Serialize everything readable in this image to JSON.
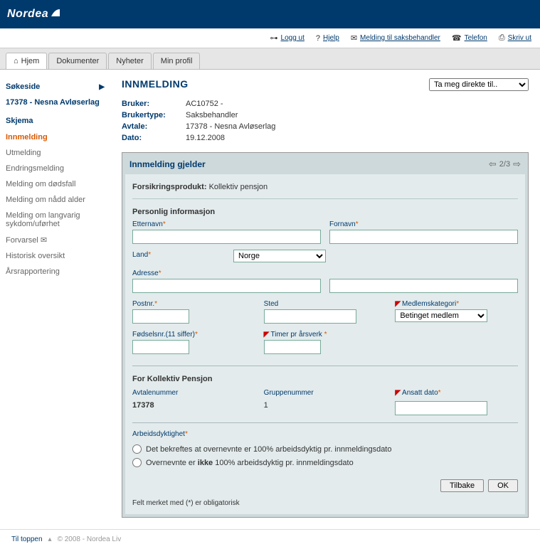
{
  "brand": "Nordea",
  "toplinks": {
    "logout": "Logg ut",
    "help": "Hjelp",
    "message": "Melding til saksbehandler",
    "phone": "Telefon",
    "print": "Skriv ut"
  },
  "tabs": {
    "home": "Hjem",
    "documents": "Dokumenter",
    "news": "Nyheter",
    "profile": "Min profil"
  },
  "sidebar": {
    "search": "Søkeside",
    "agreement": "17378 - Nesna Avløserlag",
    "schema": "Skjema",
    "items": [
      "Innmelding",
      "Utmelding",
      "Endringsmelding",
      "Melding om dødsfall",
      "Melding om nådd alder",
      "Melding om langvarig sykdom/uførhet",
      "Forvarsel",
      "Historisk oversikt",
      "Årsrapportering"
    ]
  },
  "page": {
    "title": "INNMELDING",
    "jump_placeholder": "Ta meg direkte til..",
    "info": {
      "bruker_label": "Bruker:",
      "bruker": "AC10752 -",
      "brukertype_label": "Brukertype:",
      "brukertype": "Saksbehandler",
      "avtale_label": "Avtale:",
      "avtale": "17378 - Nesna Avløserlag",
      "dato_label": "Dato:",
      "dato": "19.12.2008"
    }
  },
  "form": {
    "head": "Innmelding gjelder",
    "pager": "2/3",
    "produkt_label": "Forsikringsprodukt:",
    "produkt": "Kollektiv pensjon",
    "personal_title": "Personlig informasjon",
    "etternavn": "Etternavn",
    "fornavn": "Fornavn",
    "land": "Land",
    "land_val": "Norge",
    "adresse": "Adresse",
    "postnr": "Postnr.",
    "sted": "Sted",
    "medlemskat": "Medlemskategori",
    "medlemskat_val": "Betinget medlem",
    "fodsel": "Fødselsnr.(11 siffer)",
    "timer": "Timer pr årsverk",
    "kp_title": "For Kollektiv Pensjon",
    "avtalenr_label": "Avtalenummer",
    "avtalenr": "17378",
    "gruppe_label": "Gruppenummer",
    "gruppe": "1",
    "ansatt_label": "Ansatt dato",
    "arbeid_label": "Arbeidsdyktighet",
    "radio1_a": "Det bekreftes at overnevnte er 100% arbeidsdyktig pr. innmeldingsdato",
    "radio2_a": "Overnevnte er ",
    "radio2_b": "ikke",
    "radio2_c": " 100% arbeidsdyktig pr. innmeldingsdato",
    "btn_back": "Tilbake",
    "btn_ok": "OK",
    "note": "Felt merket med (*) er obligatorisk"
  },
  "footer": {
    "top": "Til toppen",
    "copy": "© 2008 - Nordea Liv"
  }
}
